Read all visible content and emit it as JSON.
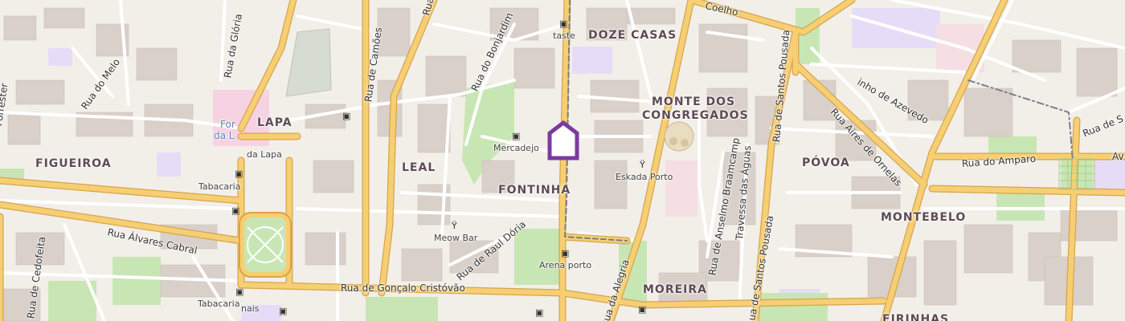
{
  "map": {
    "colors": {
      "background": "#f2efe9",
      "road_major": "#f7cf73",
      "road_major_casing": "#d7a34f",
      "road_minor": "#ffffff",
      "building": "#d9d0c9",
      "park": "#c8e6b4",
      "purple_area": "#e6dcf7",
      "marker": "#7b3aa0"
    },
    "places": {
      "doze_casas": "DOZE CASAS",
      "monte_dos_congregados_1": "MONTE DOS",
      "monte_dos_congregados_2": "CONGREGADOS",
      "lapa": "LAPA",
      "figueiroa": "FIGUEIROA",
      "leal": "LEAL",
      "fontinha": "FONTINHA",
      "povoa": "PÓVOA",
      "montebelo": "MONTEBELO",
      "moreira": "MOREIRA",
      "firinhas": "FIRINHAS"
    },
    "streets": {
      "rua_da_gloria": "Rua da Glória",
      "rua_do_melo": "Rua do Melo",
      "rua_de_camoes": "Rua de Camões",
      "rua_do_bonjardim": "Rua do Bonjardim",
      "coelho": "Coelho",
      "rua_de_santos_pousada_top": "Rua de Santos Pousada",
      "inho_de_azevedo": "inho de Azevedo",
      "rua_aires_de_ornelas": "Rua Aires de Ornelas",
      "rua_do_amparo": "Rua do Amparo",
      "rua_de_s": "Rua de S",
      "rua_alvares_cabral": "Rua Álvares Cabral",
      "rua_de_cedofeita": "Rua de Cedofeita",
      "rua_de_raul_doria": "Rua de Raul Dória",
      "rua_de_goncalo_cristovao": "Rua de Gonçalo Cristóvão",
      "rua_da_alegria": "Rua da Alegria",
      "rua_de_anselmo_braamcamp": "Rua de Anselmo Braamcamp",
      "travessa_das_aguas": "Travessa das Águas",
      "rua_de_santos_pousada_bottom": "Rua de Santos Pousada",
      "forrester": "Forrester",
      "rua_top": "Rua",
      "av": "Av"
    },
    "pois": {
      "taste": "taste",
      "mercadejo": "Mercadejo",
      "eskada_porto": "Eskada Porto",
      "meow_bar": "Meow Bar",
      "arena_porto": "Arena porto",
      "tabacaria_1": "Tabacaria",
      "tabacaria_2": "Tabacaria",
      "da_lapa": "da Lapa",
      "fort_label_1": "For",
      "fort_label_2": "da L",
      "nais": "nais"
    },
    "icons": {
      "shop": "▣",
      "bar": "Ÿ",
      "marker": "home-marker-icon"
    }
  }
}
